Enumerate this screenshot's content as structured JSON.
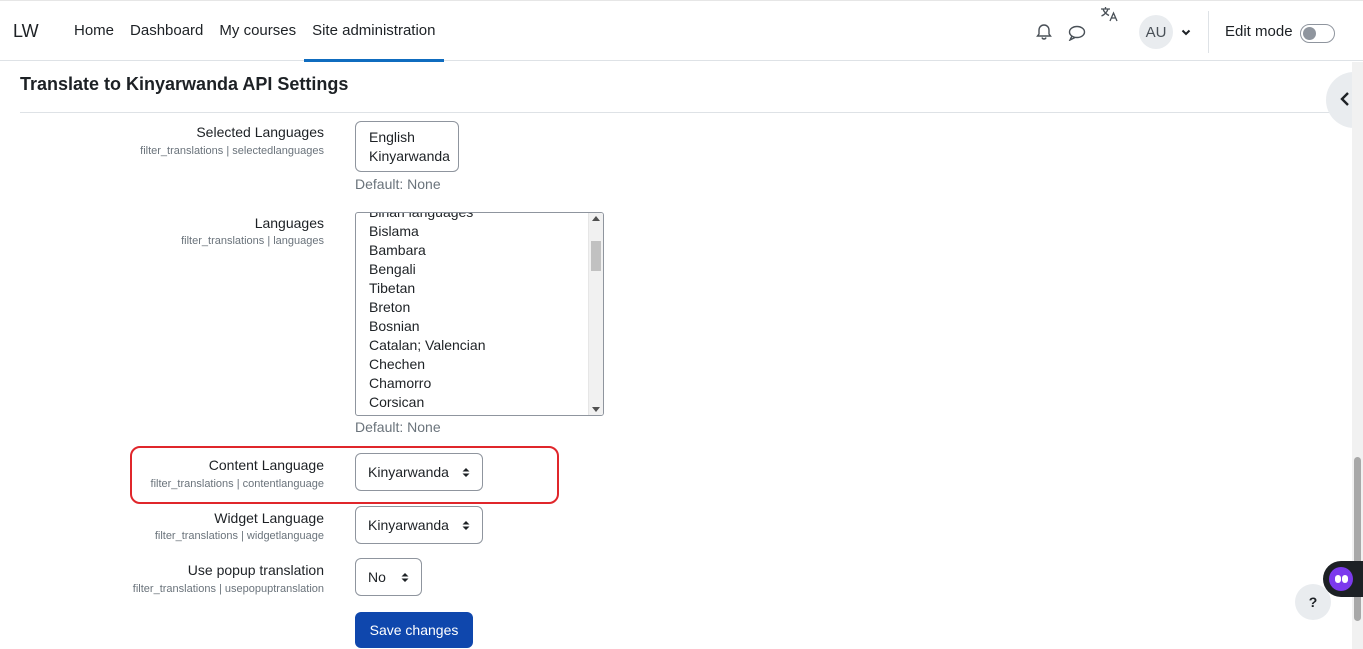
{
  "brand": {
    "logo": "LW"
  },
  "nav": {
    "items": [
      {
        "label": "Home"
      },
      {
        "label": "Dashboard"
      },
      {
        "label": "My courses"
      },
      {
        "label": "Site administration"
      }
    ]
  },
  "user": {
    "initials": "AU"
  },
  "edit_mode": {
    "label": "Edit mode",
    "enabled": false
  },
  "page": {
    "heading": "Translate to Kinyarwanda API Settings"
  },
  "settings": {
    "selected_languages": {
      "label": "Selected Languages",
      "id": "filter_translations | selectedlanguages",
      "options": [
        "English",
        "Kinyarwanda"
      ],
      "default": "Default: None"
    },
    "languages": {
      "label": "Languages",
      "id": "filter_translations | languages",
      "options": [
        "Bihari languages",
        "Bislama",
        "Bambara",
        "Bengali",
        "Tibetan",
        "Breton",
        "Bosnian",
        "Catalan; Valencian",
        "Chechen",
        "Chamorro",
        "Corsican"
      ],
      "default": "Default: None"
    },
    "content_language": {
      "label": "Content Language",
      "id": "filter_translations | contentlanguage",
      "value": "Kinyarwanda"
    },
    "widget_language": {
      "label": "Widget Language",
      "id": "filter_translations | widgetlanguage",
      "value": "Kinyarwanda"
    },
    "use_popup": {
      "label": "Use popup translation",
      "id": "filter_translations | usepopuptranslation",
      "value": "No"
    },
    "save_label": "Save changes"
  },
  "help": {
    "label": "?"
  },
  "colors": {
    "primary": "#0f47ad",
    "nav_active": "#0f6cbf",
    "highlight": "#e0262b"
  }
}
